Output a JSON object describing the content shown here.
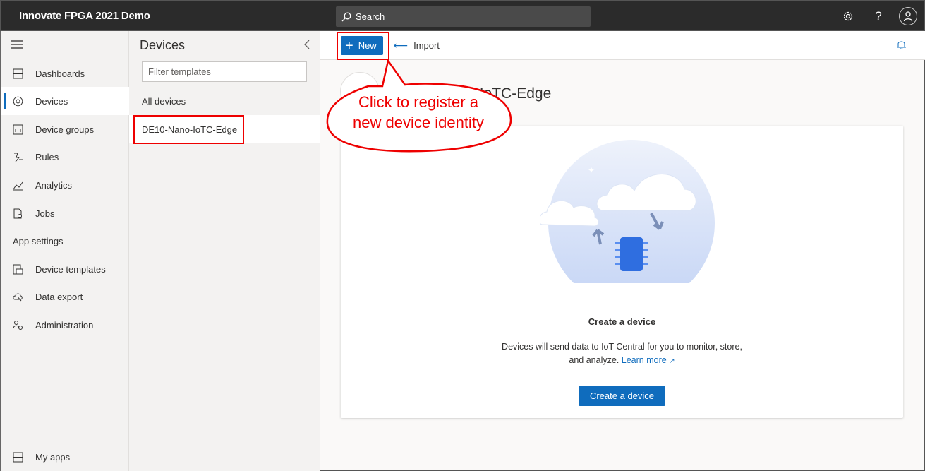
{
  "app": {
    "title": "Innovate FPGA 2021 Demo"
  },
  "topbar": {
    "search_label": "Search",
    "icons": [
      "search-icon",
      "settings-icon",
      "help-icon",
      "account-icon"
    ]
  },
  "nav": {
    "items": [
      {
        "label": "Dashboards",
        "icon": "dashboards-icon"
      },
      {
        "label": "Devices",
        "icon": "devices-icon",
        "active": true
      },
      {
        "label": "Device groups",
        "icon": "device-groups-icon"
      },
      {
        "label": "Rules",
        "icon": "rules-icon"
      },
      {
        "label": "Analytics",
        "icon": "analytics-icon"
      },
      {
        "label": "Jobs",
        "icon": "jobs-icon"
      }
    ],
    "section_label": "App settings",
    "settings_items": [
      {
        "label": "Device templates",
        "icon": "device-templates-icon"
      },
      {
        "label": "Data export",
        "icon": "data-export-icon"
      },
      {
        "label": "Administration",
        "icon": "administration-icon"
      }
    ],
    "bottom_label": "My apps"
  },
  "devices_panel": {
    "title": "Devices",
    "filter_placeholder": "Filter templates",
    "all_devices": "All devices",
    "selected_template": "DE10-Nano-IoTC-Edge"
  },
  "commandbar": {
    "new_label": "New",
    "import_label": "Import"
  },
  "main": {
    "device_title": "DE10-Nano-IoTC-Edge",
    "card": {
      "title": "Create a device",
      "desc_line1": "Devices will send data to IoT Central for you to monitor, store,",
      "desc_line2": "and analyze.",
      "learn_more": "Learn more",
      "button": "Create a device"
    }
  },
  "callout": {
    "line1": "Click to register a",
    "line2": "new device identity",
    "color": "#e00000"
  },
  "colors": {
    "accent": "#0f6cbd",
    "topbar": "#2b2b2b",
    "nav_bg": "#f3f2f1"
  }
}
